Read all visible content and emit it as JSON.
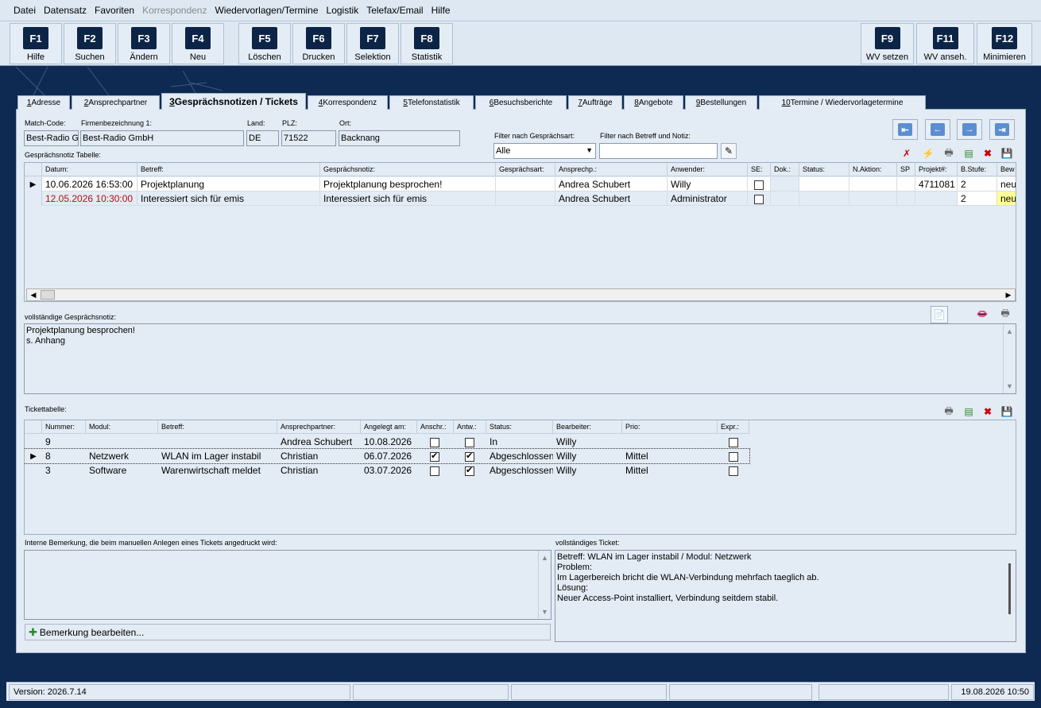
{
  "menu": [
    "Datei",
    "Datensatz",
    "Favoriten",
    "Korrespondenz",
    "Wiedervorlagen/Termine",
    "Logistik",
    "Telefax/Email",
    "Hilfe"
  ],
  "fkeys": [
    {
      "key": "F1",
      "label": "Hilfe"
    },
    {
      "key": "F2",
      "label": "Suchen"
    },
    {
      "key": "F3",
      "label": "Ändern"
    },
    {
      "key": "F4",
      "label": "Neu"
    },
    {
      "key": "F5",
      "label": "Löschen"
    },
    {
      "key": "F6",
      "label": "Drucken"
    },
    {
      "key": "F7",
      "label": "Selektion"
    },
    {
      "key": "F8",
      "label": "Statistik"
    },
    {
      "key": "F9",
      "label": "WV setzen"
    },
    {
      "key": "F11",
      "label": "WV anseh."
    },
    {
      "key": "F12",
      "label": "Minimieren"
    }
  ],
  "tabs": [
    {
      "num": "1",
      "label": " Adresse"
    },
    {
      "num": "2",
      "label": " Ansprechpartner"
    },
    {
      "num": "3",
      "label": " Gesprächsnotizen / Tickets"
    },
    {
      "num": "4",
      "label": " Korrespondenz"
    },
    {
      "num": "5",
      "label": " Telefonstatistik"
    },
    {
      "num": "6",
      "label": " Besuchsberichte"
    },
    {
      "num": "7",
      "label": " Aufträge"
    },
    {
      "num": "8",
      "label": " Angebote"
    },
    {
      "num": "9",
      "label": " Bestellungen"
    },
    {
      "num": "10",
      "label": " Termine / Wiedervorlagetermine"
    }
  ],
  "header": {
    "match_code_label": "Match-Code:",
    "match_code": "Best-Radio Gr",
    "firma_label": "Firmenbezeichnung 1:",
    "firma": "Best-Radio GmbH",
    "land_label": "Land:",
    "land": "DE",
    "plz_label": "PLZ:",
    "plz": "71522",
    "ort_label": "Ort:",
    "ort": "Backnang",
    "filter_art_label": "Filter nach Gesprächsart:",
    "filter_art": "Alle",
    "filter_betreff_label": "Filter nach Betreff und Notiz:",
    "filter_betreff": ""
  },
  "notes_table": {
    "title": "Gesprächsnotiz Tabelle:",
    "columns": [
      "Datum:",
      "Betreff:",
      "Gesprächsnotiz:",
      "Gesprächsart:",
      "Ansprechp.:",
      "Anwender:",
      "SE:",
      "Dok.:",
      "Status:",
      "N.Aktion:",
      "SP",
      "Projekt#:",
      "B.Stufe:",
      "Bew"
    ],
    "rows": [
      {
        "datum": "10.06.2026 16:53:00",
        "betreff": "Projektplanung",
        "notiz": "Projektplanung besprochen!",
        "art": "",
        "ansprech": "Andrea Schubert",
        "anwender": "Willy",
        "se": false,
        "dok": "",
        "status": "",
        "naktion": "",
        "sp": "",
        "projekt": "4711081",
        "bstufe": "2",
        "bew": "neu"
      },
      {
        "datum": "12.05.2026 10:30:00",
        "betreff": "Interessiert sich für emis",
        "notiz": "Interessiert sich für emis",
        "art": "",
        "ansprech": "Andrea Schubert",
        "anwender": "Administrator",
        "se": false,
        "dok": "",
        "status": "",
        "naktion": "",
        "sp": "",
        "projekt": "",
        "bstufe": "2",
        "bew": "neu"
      }
    ]
  },
  "full_note": {
    "label": "vollständige Gesprächsnotiz:",
    "lines": [
      "Projektplanung besprochen!",
      "s. Anhang"
    ]
  },
  "ticket_table": {
    "title": "Tickettabelle:",
    "columns": [
      "Nummer:",
      "Modul:",
      "Betreff:",
      "Ansprechpartner:",
      "Angelegt am:",
      "Anschr.:",
      "Antw.:",
      "Status:",
      "Bearbeiter:",
      "Prio:",
      "Expr.:"
    ],
    "rows": [
      {
        "nummer": "9",
        "modul": "",
        "betreff": "",
        "ansprech": "Andrea Schubert",
        "angelegt": "10.08.2026",
        "anschr": false,
        "antw": false,
        "status": "In",
        "bearbeiter": "Willy",
        "prio": "",
        "expr": false
      },
      {
        "nummer": "8",
        "modul": "Netzwerk",
        "betreff": "WLAN im Lager instabil",
        "ansprech": "Christian",
        "angelegt": "06.07.2026",
        "anschr": true,
        "antw": true,
        "status": "Abgeschlossen",
        "bearbeiter": "Willy",
        "prio": "Mittel",
        "expr": false
      },
      {
        "nummer": "3",
        "modul": "Software",
        "betreff": "Warenwirtschaft meldet",
        "ansprech": "Christian",
        "angelegt": "03.07.2026",
        "anschr": false,
        "antw": true,
        "status": "Abgeschlossen",
        "bearbeiter": "Willy",
        "prio": "Mittel",
        "expr": false
      }
    ]
  },
  "internal_note": {
    "label": "Interne Bemerkung, die beim manuellen Anlegen eines Tickets angedruckt wird:",
    "text": "",
    "edit_button": "Bemerkung bearbeiten..."
  },
  "full_ticket": {
    "label": "vollständiges Ticket:",
    "lines": [
      "Betreff: WLAN im Lager instabil / Modul: Netzwerk",
      "",
      "Problem:",
      "Im Lagerbereich bricht die WLAN-Verbindung mehrfach taeglich ab.",
      "",
      "Lösung:",
      "Neuer Access-Point installiert, Verbindung seitdem stabil."
    ]
  },
  "status_bar": {
    "version": "Version: 2026.7.14",
    "datetime": "19.08.2026 10:50"
  }
}
